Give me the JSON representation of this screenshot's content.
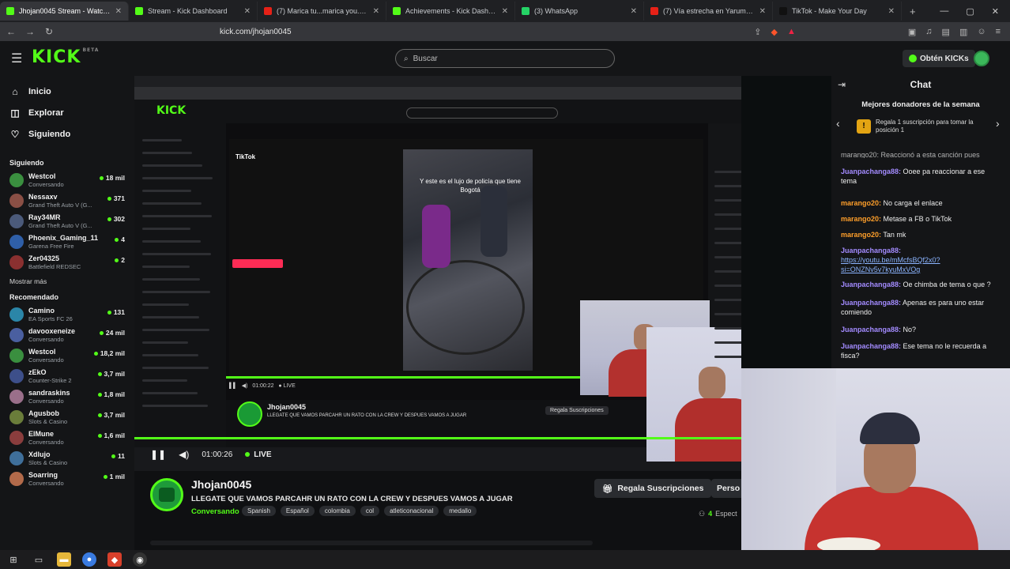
{
  "browser": {
    "tabs": [
      {
        "title": "Jhojan0045 Stream - Watch ...",
        "color": "#53fc18",
        "active": true
      },
      {
        "title": "Stream - Kick Dashboard",
        "color": "#53fc18",
        "active": false
      },
      {
        "title": "(7) Marica tu...marica you. fiesta pl...",
        "color": "#e62117",
        "active": false
      },
      {
        "title": "Achievements - Kick Dashboard",
        "color": "#53fc18",
        "active": false
      },
      {
        "title": "(3) WhatsApp",
        "color": "#25d366",
        "active": false
      },
      {
        "title": "(7) Vía estrecha en Yarumal, Antioq...",
        "color": "#e62117",
        "active": false
      },
      {
        "title": "TikTok - Make Your Day",
        "color": "#111111",
        "active": false
      }
    ],
    "url": "kick.com/jhojan0045"
  },
  "header": {
    "logo": "KICK",
    "logo_sup": "BETA",
    "search_placeholder": "Buscar",
    "kicks_button": "Obtén KICKs"
  },
  "sidebar": {
    "nav": [
      {
        "label": "Inicio",
        "icon": "home-icon",
        "glyph": "⌂"
      },
      {
        "label": "Explorar",
        "icon": "compass-icon",
        "glyph": "◫"
      },
      {
        "label": "Siguiendo",
        "icon": "heart-icon",
        "glyph": "♡"
      }
    ],
    "following_title": "Siguiendo",
    "following": [
      {
        "name": "Westcol",
        "category": "Conversando",
        "viewers": "18 mil",
        "color": "#3a8f3f"
      },
      {
        "name": "Nessaxv",
        "category": "Grand Theft Auto V (G...",
        "viewers": "371",
        "color": "#8a4f45"
      },
      {
        "name": "Ray34MR",
        "category": "Grand Theft Auto V (G...",
        "viewers": "302",
        "color": "#4b5a7a"
      },
      {
        "name": "Phoenix_Gaming_11",
        "category": "Garena Free Fire",
        "viewers": "4",
        "color": "#2f5fa8"
      },
      {
        "name": "Zer04325",
        "category": "Battlefield REDSEC",
        "viewers": "2",
        "color": "#8a3030"
      }
    ],
    "show_more": "Mostrar más",
    "recommended_title": "Recomendado",
    "recommended": [
      {
        "name": "Camino",
        "category": "EA Sports FC 26",
        "viewers": "131",
        "color": "#2b86a8"
      },
      {
        "name": "davooxeneize",
        "category": "Conversando",
        "viewers": "24 mil",
        "color": "#4a5fa0"
      },
      {
        "name": "Westcol",
        "category": "Conversando",
        "viewers": "18,2 mil",
        "color": "#3a8f3f"
      },
      {
        "name": "zEkO",
        "category": "Counter-Strike 2",
        "viewers": "3,7 mil",
        "color": "#3d4f8a"
      },
      {
        "name": "sandraskins",
        "category": "Conversando",
        "viewers": "1,8 mil",
        "color": "#9a6f8a"
      },
      {
        "name": "Agusbob",
        "category": "Slots & Casino",
        "viewers": "3,7 mil",
        "color": "#6a7d3a"
      },
      {
        "name": "ElMune",
        "category": "Conversando",
        "viewers": "1,6 mil",
        "color": "#8a3d3d"
      },
      {
        "name": "Xdlujo",
        "category": "Slots & Casino",
        "viewers": "11",
        "color": "#3f6f9a"
      },
      {
        "name": "Soarring",
        "category": "Conversando",
        "viewers": "1 mil",
        "color": "#b26a4a"
      }
    ]
  },
  "inner_capture": {
    "logo": "KICK",
    "tiktok_logo": "TikTok",
    "tiktok_caption": "Y este es el lujo de policía que tiene Bogotá",
    "time": "01:00:22",
    "live": "LIVE",
    "streamer": "Jhojan0045",
    "title": "LLEGATE QUE VAMOS PARCAHR UN RATO CON LA CREW Y DESPUES VAMOS A JUGAR",
    "gift": "Regala Suscripciones"
  },
  "player": {
    "time": "01:00:26",
    "live_label": "LIVE"
  },
  "stream": {
    "streamer": "Jhojan0045",
    "title": "LLEGATE QUE VAMOS  PARCAHR UN RATO CON LA CREW Y DESPUES VAMOS A JUGAR",
    "category": "Conversando",
    "tags": [
      "Spanish",
      "Español",
      "colombia",
      "col",
      "atleticonacional",
      "medallo"
    ],
    "gift_button": "Regala Suscripciones",
    "person_button": "Perso",
    "viewers": "4",
    "viewers_label": "Espect"
  },
  "chat": {
    "title": "Chat",
    "donors_title": "Mejores donadores de la semana",
    "donors_text": "Regala 1 suscripción para tomar la posición 1",
    "messages": [
      {
        "user": "Juanpachanga88:",
        "text": "Ooee pa reaccionar a ese tema",
        "color": "purple"
      },
      {
        "user": "marango20:",
        "text": "No carga el enlace",
        "color": "orange"
      },
      {
        "user": "marango20:",
        "text": "Metase a FB o TikTok",
        "color": "orange"
      },
      {
        "user": "marango20:",
        "text": "Tan mk",
        "color": "orange"
      },
      {
        "user": "Juanpachanga88:",
        "text": "",
        "link": "https://youtu.be/mMcfsBQf2x0?si=ONZNv5v7kyuMxVOg",
        "color": "purple"
      },
      {
        "user": "Juanpachanga88:",
        "text": "Oe chimba de tema o que ?",
        "color": "purple"
      },
      {
        "user": "Juanpachanga88:",
        "text": "Apenas es para uno estar comiendo",
        "color": "purple"
      },
      {
        "user": "Juanpachanga88:",
        "text": "No?",
        "color": "purple"
      },
      {
        "user": "Juanpachanga88:",
        "text": "Ese tema no le recuerda a fisca?",
        "color": "purple"
      }
    ],
    "partial_top": "marango20: Reaccionó a esta canción pues"
  }
}
